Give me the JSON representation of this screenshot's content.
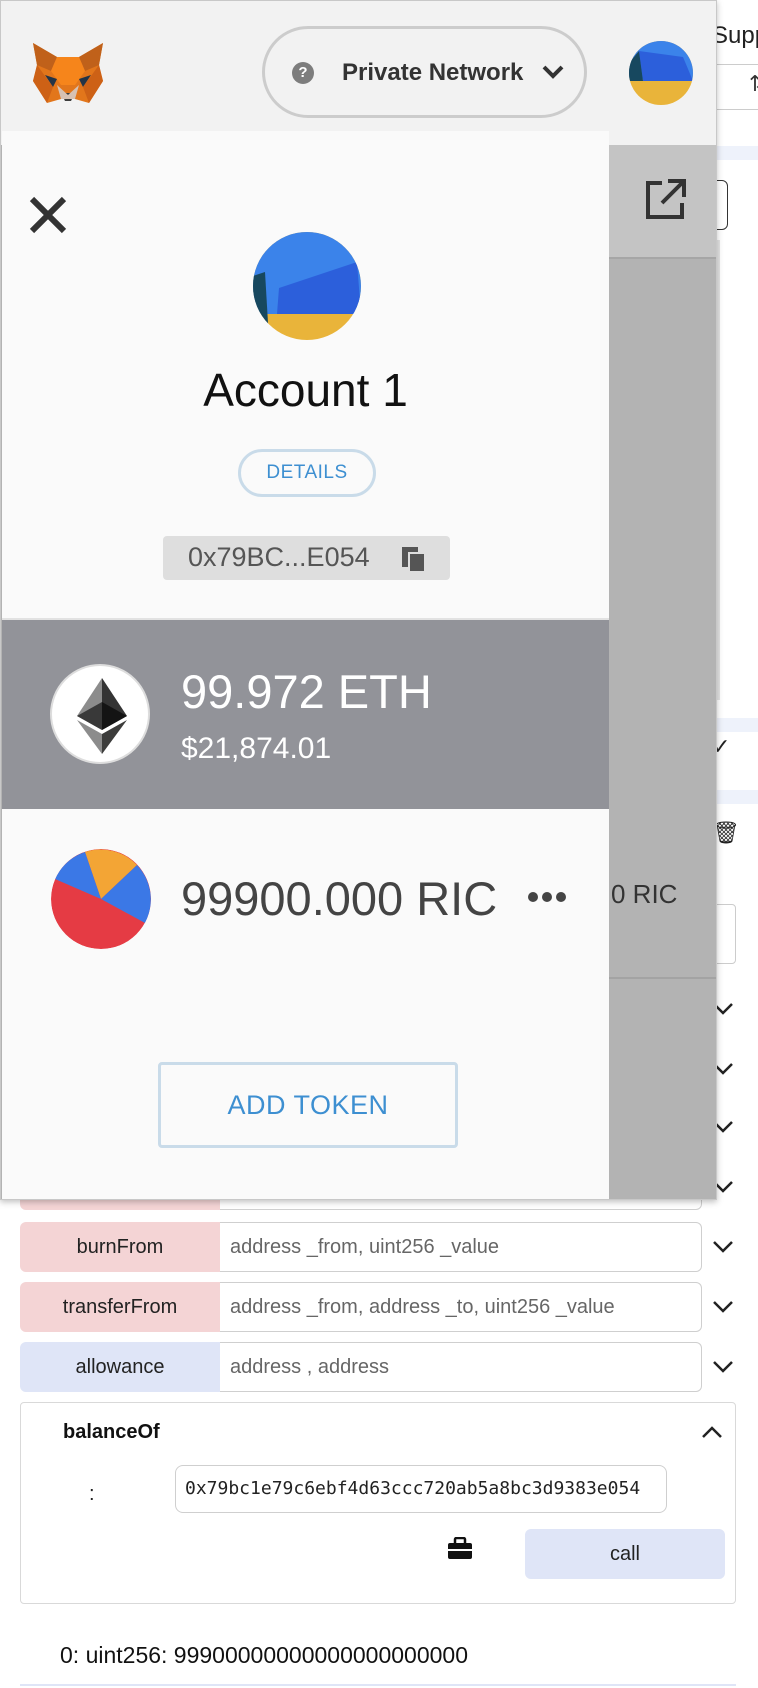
{
  "background": {
    "header_partial": "Supp",
    "ric_partial": "0 RIC",
    "functions": [
      {
        "label": "burnFrom",
        "placeholder": "address _from, uint256 _value",
        "kind": "transact"
      },
      {
        "label": "transferFrom",
        "placeholder": "address _from, address _to, uint256 _value",
        "kind": "transact"
      },
      {
        "label": "allowance",
        "placeholder": "address , address",
        "kind": "call"
      }
    ],
    "balanceOf": {
      "title": "balanceOf",
      "param_label": ":",
      "param_value": "0x79bc1e79c6ebf4d63ccc720ab5a8bc3d9383e054",
      "call_label": "call",
      "result": "0: uint256: 99900000000000000000000"
    }
  },
  "metamask": {
    "network": {
      "label": "Private Network",
      "help_icon": "question-icon"
    },
    "account": {
      "name": "Account 1",
      "details_label": "DETAILS",
      "address_short": "0x79BC...E054"
    },
    "eth": {
      "amount": "99.972 ETH",
      "usd": "$21,874.01"
    },
    "token": {
      "amount": "99900.000 RIC"
    },
    "add_token_label": "ADD TOKEN"
  },
  "colors": {
    "accent_blue": "#3d8fd1",
    "eth_band": "#929399",
    "transact_pink": "#f4d4d5",
    "call_blue": "#dfe5f7"
  }
}
